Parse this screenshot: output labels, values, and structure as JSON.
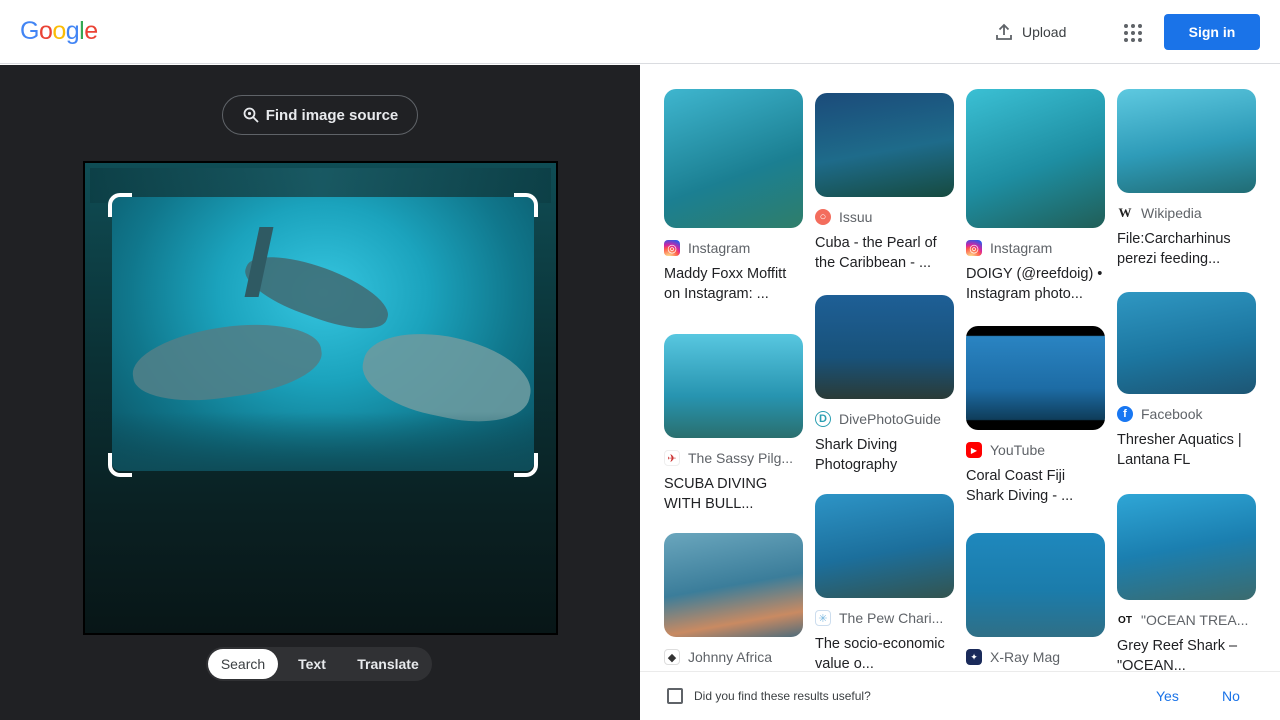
{
  "header": {
    "logo_letters": [
      "G",
      "o",
      "o",
      "g",
      "l",
      "e"
    ],
    "logo_colors": [
      "#4285f4",
      "#ea4335",
      "#fbbc05",
      "#4285f4",
      "#34a853",
      "#ea4335"
    ],
    "upload_label": "Upload",
    "signin_label": "Sign in"
  },
  "left": {
    "find_source_label": "Find image source",
    "modes": [
      "Search",
      "Text",
      "Translate"
    ],
    "active_mode": "Search"
  },
  "results": [
    {
      "source": "Instagram",
      "title": "Maddy Foxx Moffitt on Instagram: ..."
    },
    {
      "source": "The Sassy Pilg...",
      "title": "SCUBA DIVING WITH BULL..."
    },
    {
      "source": "Johnny Africa",
      "title": ""
    },
    {
      "source": "Issuu",
      "title": "Cuba - the Pearl of the Caribbean - ..."
    },
    {
      "source": "DivePhotoGuide",
      "title": "Shark Diving Photography"
    },
    {
      "source": "The Pew Chari...",
      "title": "The socio-economic value o..."
    },
    {
      "source": "Instagram",
      "title": "DOIGY (@reefdoig) • Instagram photo..."
    },
    {
      "source": "YouTube",
      "title": "Coral Coast Fiji Shark Diving - ..."
    },
    {
      "source": "X-Ray Mag",
      "title": ""
    },
    {
      "source": "Wikipedia",
      "title": "File:Carcharhinus perezi feeding..."
    },
    {
      "source": "Facebook",
      "title": "Thresher Aquatics | Lantana FL"
    },
    {
      "source": "\"OCEAN TREA...",
      "title": "Grey Reef Shark – \"OCEAN..."
    }
  ],
  "feedback": {
    "question": "Did you find these results useful?",
    "yes": "Yes",
    "no": "No"
  }
}
